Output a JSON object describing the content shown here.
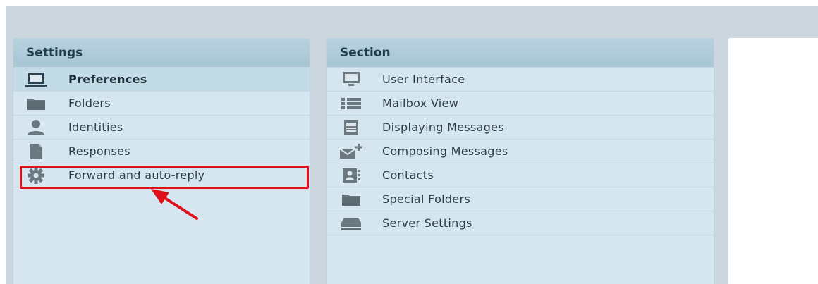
{
  "settings": {
    "header": "Settings",
    "items": [
      {
        "label": "Preferences",
        "icon": "monitor-icon",
        "selected": true
      },
      {
        "label": "Folders",
        "icon": "folder-icon"
      },
      {
        "label": "Identities",
        "icon": "person-icon"
      },
      {
        "label": "Responses",
        "icon": "document-icon"
      },
      {
        "label": "Forward and auto-reply",
        "icon": "gear-icon"
      }
    ]
  },
  "section": {
    "header": "Section",
    "items": [
      {
        "label": "User Interface",
        "icon": "monitor-icon"
      },
      {
        "label": "Mailbox View",
        "icon": "list-icon"
      },
      {
        "label": "Displaying Messages",
        "icon": "message-icon"
      },
      {
        "label": "Composing Messages",
        "icon": "compose-envelope-icon"
      },
      {
        "label": "Contacts",
        "icon": "contact-card-icon"
      },
      {
        "label": "Special Folders",
        "icon": "folder-icon"
      },
      {
        "label": "Server Settings",
        "icon": "server-icon"
      }
    ]
  },
  "annotation": {
    "highlight_color": "#e0101a"
  },
  "colors": {
    "panel_bg": "#d5e6f0",
    "header_bg": "#b7d1de",
    "selected_bg": "#c3dbe7"
  }
}
